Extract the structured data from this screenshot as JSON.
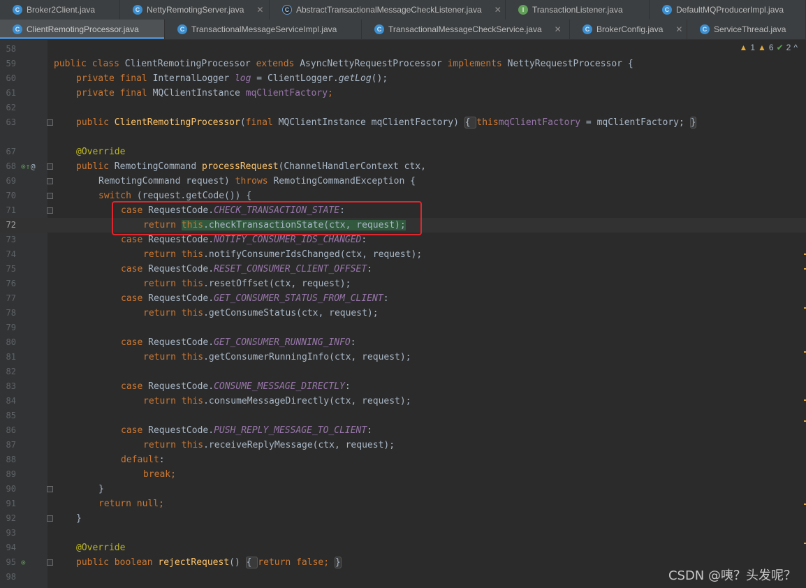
{
  "tabs_row1": [
    {
      "label": "Broker2Client.java",
      "icon": "class-icon"
    },
    {
      "label": "NettyRemotingServer.java",
      "icon": "class-icon"
    },
    {
      "label": "AbstractTransactionalMessageCheckListener.java",
      "icon": "abstract-class-icon"
    },
    {
      "label": "TransactionListener.java",
      "icon": "interface-icon"
    },
    {
      "label": "DefaultMQProducerImpl.java",
      "icon": "class-icon"
    }
  ],
  "tabs_row2": [
    {
      "label": "ClientRemotingProcessor.java",
      "icon": "class-icon",
      "active": true
    },
    {
      "label": "TransactionalMessageServiceImpl.java",
      "icon": "class-icon"
    },
    {
      "label": "TransactionalMessageCheckService.java",
      "icon": "class-icon"
    },
    {
      "label": "BrokerConfig.java",
      "icon": "class-icon"
    },
    {
      "label": "ServiceThread.java",
      "icon": "class-icon"
    }
  ],
  "inspections": {
    "warning_a": "1",
    "warning_b": "6",
    "typo": "2",
    "chevron": "^"
  },
  "line_numbers": [
    "58",
    "59",
    "60",
    "61",
    "62",
    "63",
    "67",
    "68",
    "69",
    "70",
    "71",
    "72",
    "73",
    "74",
    "75",
    "76",
    "77",
    "78",
    "79",
    "80",
    "81",
    "82",
    "83",
    "84",
    "85",
    "86",
    "87",
    "88",
    "89",
    "90",
    "91",
    "92",
    "93",
    "94",
    "95",
    "98"
  ],
  "code": {
    "l59": {
      "kw1": "public class ",
      "cls": "ClientRemotingProcessor ",
      "kw2": "extends ",
      "base": "AsyncNettyRequestProcessor ",
      "kw3": "implements ",
      "iface": "NettyRequestProcessor {"
    },
    "l60": {
      "kw": "private final ",
      "type": "InternalLogger ",
      "fld": "log",
      "rest": " = ClientLogger.",
      "call": "getLog",
      "end": "();"
    },
    "l61": {
      "kw": "private final ",
      "type": "MQClientInstance ",
      "fld": "mqClientFactory",
      "end": ";"
    },
    "l63": {
      "kw": "public ",
      "fn": "ClientRemotingProcessor",
      "p1": "(",
      "kw2": "final ",
      "params": "MQClientInstance mqClientFactory)",
      "fo": "{ ",
      "kw3": "this",
      ".": ".",
      "fld": "mqClientFactory",
      " eq": " = mqClientFactory; ",
      "fc": "}"
    },
    "l67": {
      "ann": "@Override"
    },
    "l68": {
      "kw": "public ",
      "type": "RemotingCommand ",
      "fn": "processRequest",
      "rest": "(ChannelHandlerContext ctx,"
    },
    "l69": {
      "rest": "RemotingCommand request) ",
      "kw": "throws ",
      "exc": "RemotingCommandException {"
    },
    "l70": {
      "kw": "switch ",
      "rest": "(request.getCode()) {"
    },
    "l71": {
      "kw": "case ",
      "rest": "RequestCode.",
      "cst": "CHECK_TRANSACTION_STATE",
      ":": ":"
    },
    "l72": {
      "kw": "return ",
      "kw2": "this",
      "rest": ".checkTransactionState(ctx, request);"
    },
    "l73": {
      "kw": "case ",
      "rest": "RequestCode.",
      "cst": "NOTIFY_CONSUMER_IDS_CHANGED",
      ":": ":"
    },
    "l74": {
      "kw": "return ",
      "kw2": "this",
      "rest": ".notifyConsumerIdsChanged(ctx, request);"
    },
    "l75": {
      "kw": "case ",
      "rest": "RequestCode.",
      "cst": "RESET_CONSUMER_CLIENT_OFFSET",
      ":": ":"
    },
    "l76": {
      "kw": "return ",
      "kw2": "this",
      "rest": ".resetOffset(ctx, request);"
    },
    "l77": {
      "kw": "case ",
      "rest": "RequestCode.",
      "cst": "GET_CONSUMER_STATUS_FROM_CLIENT",
      ":": ":"
    },
    "l78": {
      "kw": "return ",
      "kw2": "this",
      "rest": ".getConsumeStatus(ctx, request);"
    },
    "l80": {
      "kw": "case ",
      "rest": "RequestCode.",
      "cst": "GET_CONSUMER_RUNNING_INFO",
      ":": ":"
    },
    "l81": {
      "kw": "return ",
      "kw2": "this",
      "rest": ".getConsumerRunningInfo(ctx, request);"
    },
    "l83": {
      "kw": "case ",
      "rest": "RequestCode.",
      "cst": "CONSUME_MESSAGE_DIRECTLY",
      ":": ":"
    },
    "l84": {
      "kw": "return ",
      "kw2": "this",
      "rest": ".consumeMessageDirectly(ctx, request);"
    },
    "l86": {
      "kw": "case ",
      "rest": "RequestCode.",
      "cst": "PUSH_REPLY_MESSAGE_TO_CLIENT",
      ":": ":"
    },
    "l87": {
      "kw": "return ",
      "kw2": "this",
      "rest": ".receiveReplyMessage(ctx, request);"
    },
    "l88": {
      "kw": "default",
      ":": ":"
    },
    "l89": {
      "kw": "break",
      ";": ";"
    },
    "l90": {
      "rest": "}"
    },
    "l91": {
      "kw": "return null",
      ";": ";"
    },
    "l92": {
      "rest": "}"
    },
    "l94": {
      "ann": "@Override"
    },
    "l95": {
      "kw": "public boolean ",
      "fn": "rejectRequest",
      "p": "() ",
      "fo": "{ ",
      "kw2": "return false",
      ";": "; ",
      "fc": "}"
    }
  },
  "watermark": "CSDN @咦？头发呢？"
}
